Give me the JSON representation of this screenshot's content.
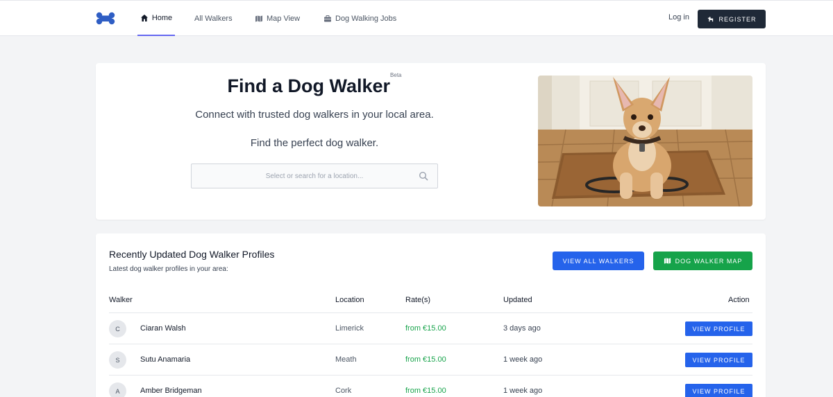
{
  "nav": {
    "items": [
      {
        "label": "Home",
        "icon": "home-icon",
        "active": true
      },
      {
        "label": "All Walkers",
        "icon": "",
        "active": false
      },
      {
        "label": "Map View",
        "icon": "map-icon",
        "active": false
      },
      {
        "label": "Dog Walking Jobs",
        "icon": "briefcase-icon",
        "active": false
      }
    ],
    "login": "Log in",
    "register": "REGISTER"
  },
  "hero": {
    "title": "Find a Dog Walker",
    "badge": "Beta",
    "subtitle": "Connect with trusted dog walkers in your local area.",
    "tagline": "Find the perfect dog walker.",
    "search_placeholder": "Select or search for a location..."
  },
  "profiles": {
    "title": "Recently Updated Dog Walker Profiles",
    "subtitle": "Latest dog walker profiles in your area:",
    "view_all": "VIEW ALL WALKERS",
    "map_button": "DOG WALKER MAP",
    "columns": {
      "walker": "Walker",
      "location": "Location",
      "rate": "Rate(s)",
      "updated": "Updated",
      "action": "Action"
    },
    "rows": [
      {
        "initial": "C",
        "name": "Ciaran Walsh",
        "location": "Limerick",
        "rate": "from €15.00",
        "updated": "3 days ago",
        "action": "VIEW PROFILE"
      },
      {
        "initial": "S",
        "name": "Sutu Anamaria",
        "location": "Meath",
        "rate": "from €15.00",
        "updated": "1 week ago",
        "action": "VIEW PROFILE"
      },
      {
        "initial": "A",
        "name": "Amber Bridgeman",
        "location": "Cork",
        "rate": "from €15.00",
        "updated": "1 week ago",
        "action": "VIEW PROFILE"
      }
    ]
  },
  "colors": {
    "brand_blue": "#2563eb",
    "brand_green": "#16a34a",
    "dark": "#1f2937",
    "accent": "#6366f1"
  }
}
